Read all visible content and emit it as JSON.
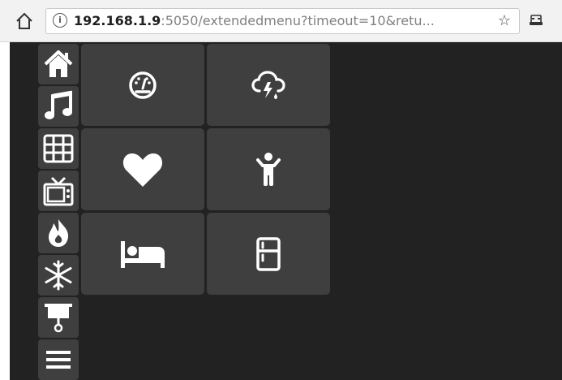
{
  "browser": {
    "url_host": "192.168.1.9",
    "url_rest": ":5050/extendedmenu?timeout=10&retu...",
    "icons": {
      "home": "home-icon",
      "info": "info-icon",
      "star": "star-icon",
      "extension": "extension-icon"
    }
  },
  "sidebar": {
    "items": [
      {
        "icon": "house-icon"
      },
      {
        "icon": "music-note-icon"
      },
      {
        "icon": "grid-icon"
      },
      {
        "icon": "tv-icon"
      },
      {
        "icon": "flame-icon"
      },
      {
        "icon": "snowflake-icon"
      },
      {
        "icon": "projector-screen-icon"
      },
      {
        "icon": "menu-icon"
      }
    ]
  },
  "grid": {
    "tiles": [
      {
        "icon": "gauge-icon"
      },
      {
        "icon": "storm-cloud-icon"
      },
      {
        "icon": "heart-icon"
      },
      {
        "icon": "child-icon"
      },
      {
        "icon": "bed-icon"
      },
      {
        "icon": "fridge-icon"
      }
    ]
  },
  "colors": {
    "background": "#222222",
    "tile": "#3f3f3f",
    "icon": "#ffffff"
  }
}
